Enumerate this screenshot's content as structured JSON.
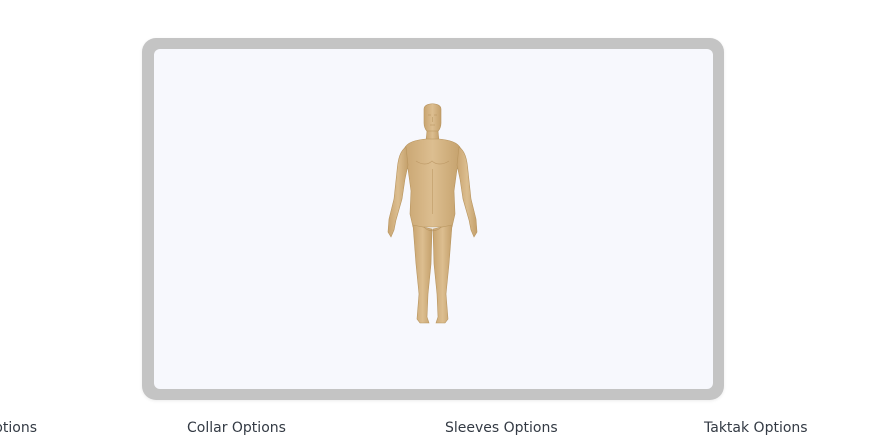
{
  "viewer": {
    "model_name": "human-mannequin-3d",
    "canvas_color": "#f7f8fd",
    "frame_color": "#c4c4c4",
    "skin_color": "#d8b98a"
  },
  "options_bar": {
    "tabs": [
      {
        "label": "Body Options",
        "visible_label": "ptions"
      },
      {
        "label": "Collar Options"
      },
      {
        "label": "Sleeves Options"
      },
      {
        "label": "Taktak Options"
      }
    ]
  }
}
